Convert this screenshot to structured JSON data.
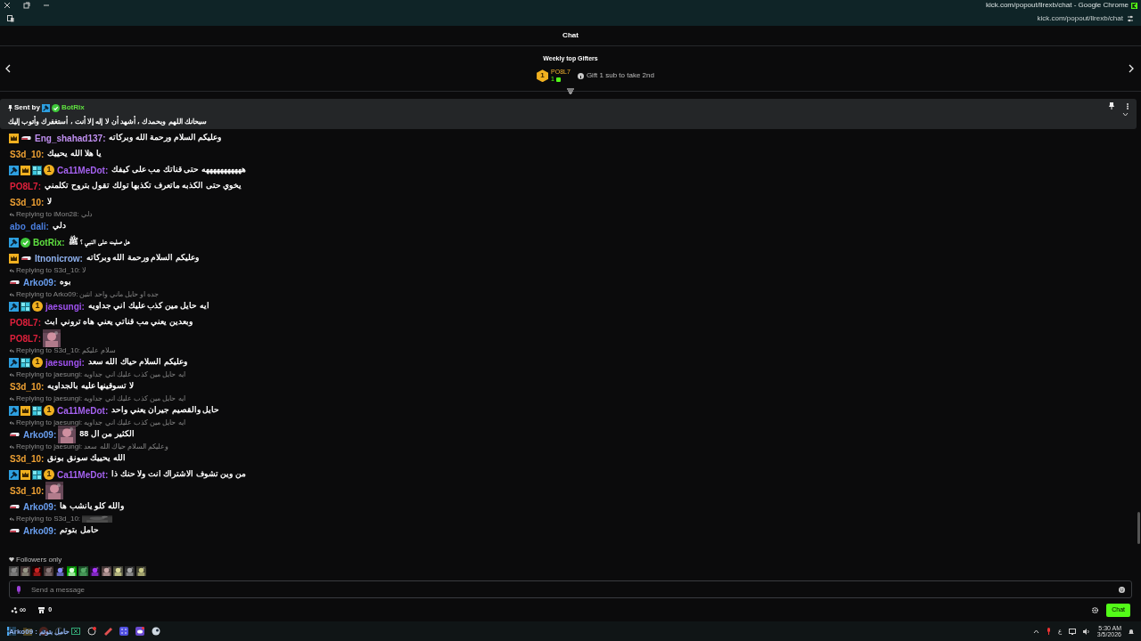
{
  "browser": {
    "title": "kick.com/popout/llrexb/chat - Google Chrome",
    "address": "kick.com/popout/llrexb/chat"
  },
  "header": {
    "title": "Chat"
  },
  "gifters": {
    "title": "Weekly top Gifters",
    "rank": "1",
    "name": "PO8L7",
    "count": "1",
    "hint": "Gift 1 sub to take 2nd"
  },
  "pinned": {
    "label": "Sent by",
    "badges": [
      {
        "kind": "moderator"
      },
      {
        "kind": "verified"
      }
    ],
    "author": "BotRix",
    "text": "سبحانك اللهم وبحمدك ، أشهد أن لا إله إلا أنت ، أستغفرك وأتوب إليك"
  },
  "messages": [
    {
      "kind": "message",
      "badges": [
        {
          "kind": "vip"
        },
        {
          "kind": "subscriber"
        }
      ],
      "author": "Eng_shahad137:",
      "color": "#c08ff0",
      "text": "وعليكم السلام ورحمة الله وبركاته"
    },
    {
      "kind": "message",
      "author": "S3d_10:",
      "color": "#f0a234",
      "text": "يا هلا الله يحييك"
    },
    {
      "kind": "message",
      "badges": [
        {
          "kind": "moderator"
        },
        {
          "kind": "vip"
        },
        {
          "kind": "og"
        },
        {
          "kind": "gifter",
          "label": "1"
        }
      ],
      "author": "Ca11MeDot:",
      "color": "#a562f0",
      "text": "هههههههههههه حتى قناتك مب على كيفك"
    },
    {
      "kind": "message",
      "author": "PO8L7:",
      "color": "#e0203c",
      "text": "يخوي حتى الكذبه ماتعرف تكذبها تولك تقول بتروح تكلمني"
    },
    {
      "kind": "message",
      "author": "S3d_10:",
      "color": "#f0a234",
      "text": "لا"
    },
    {
      "kind": "reply",
      "label": "Replying to iMon28:",
      "quote": "دلي"
    },
    {
      "kind": "message",
      "author": "abo_dali:",
      "color": "#4a7fe0",
      "text": "دلي"
    },
    {
      "kind": "message",
      "badges": [
        {
          "kind": "moderator"
        },
        {
          "kind": "verified"
        }
      ],
      "author": "BotRix:",
      "color": "#5fe040",
      "text": "هل صليت على النبي ؟ ﷺ"
    },
    {
      "kind": "message",
      "badges": [
        {
          "kind": "vip"
        },
        {
          "kind": "subscriber"
        }
      ],
      "author": "Itnonicrow:",
      "color": "#8fb2f0",
      "text": "وعليكم السلام ورحمة الله وبركاته"
    },
    {
      "kind": "reply",
      "label": "Replying to S3d_10:",
      "quote": "لا"
    },
    {
      "kind": "message",
      "badges": [
        {
          "kind": "subscriber"
        }
      ],
      "author": "Arko09:",
      "color": "#6a9ff0",
      "text": "بوه"
    },
    {
      "kind": "reply",
      "label": "Replying to Arko09:",
      "quote": "جده او حايل ماني واحد انثين"
    },
    {
      "kind": "message",
      "badges": [
        {
          "kind": "moderator"
        },
        {
          "kind": "og"
        },
        {
          "kind": "gifter",
          "label": "1"
        }
      ],
      "author": "jaesungi:",
      "color": "#a052f0",
      "text": "ايه حايل مين كذب عليك اني جداويه"
    },
    {
      "kind": "message",
      "author": "PO8L7:",
      "color": "#e0203c",
      "text": "وبعدين يعني مب قناتي يعني هاه تروني ابث"
    },
    {
      "kind": "message",
      "author": "PO8L7:",
      "color": "#e0203c",
      "emote": true
    },
    {
      "kind": "reply",
      "label": "Replying to S3d_10:",
      "quote": "سلام عليكم"
    },
    {
      "kind": "message",
      "badges": [
        {
          "kind": "moderator"
        },
        {
          "kind": "og"
        },
        {
          "kind": "gifter",
          "label": "1"
        }
      ],
      "author": "jaesungi:",
      "color": "#a052f0",
      "text": "وعليكم السلام حياك الله سعد"
    },
    {
      "kind": "reply",
      "label": "Replying to jaesungi:",
      "quote": "ايه حايل مين كذب عليك اني جداويه"
    },
    {
      "kind": "message",
      "author": "S3d_10:",
      "color": "#f0a234",
      "text": "لا تسوقينها عليه بالجداويه"
    },
    {
      "kind": "reply",
      "label": "Replying to jaesungi:",
      "quote": "ايه حايل مين كذب عليك اني جداويه"
    },
    {
      "kind": "message",
      "badges": [
        {
          "kind": "moderator"
        },
        {
          "kind": "vip"
        },
        {
          "kind": "og"
        },
        {
          "kind": "gifter",
          "label": "1"
        }
      ],
      "author": "Ca11MeDot:",
      "color": "#a562f0",
      "text": "حايل والقصيم جيران يعني واحد"
    },
    {
      "kind": "reply",
      "label": "Replying to jaesungi:",
      "quote": "ايه حايل مين كذب عليك اني جداويه"
    },
    {
      "kind": "message",
      "badges": [
        {
          "kind": "subscriber"
        }
      ],
      "author": "Arko09:",
      "color": "#6a9ff0",
      "emote": true,
      "text": "الكثير من ال 88"
    },
    {
      "kind": "reply",
      "label": "Replying to jaesungi:",
      "quote": "وعليكم السلام حياك الله سعد"
    },
    {
      "kind": "message",
      "author": "S3d_10:",
      "color": "#f0a234",
      "text": "الله يحييك سونق بونق"
    },
    {
      "kind": "message",
      "badges": [
        {
          "kind": "moderator"
        },
        {
          "kind": "vip"
        },
        {
          "kind": "og"
        },
        {
          "kind": "gifter",
          "label": "1"
        }
      ],
      "author": "Ca11MeDot:",
      "color": "#a562f0",
      "text": "من وين تشوف الاشتراك انت ولا حنك ذا"
    },
    {
      "kind": "message",
      "author": "S3d_10:",
      "color": "#f0a234",
      "emote": true
    },
    {
      "kind": "message",
      "badges": [
        {
          "kind": "subscriber"
        }
      ],
      "author": "Arko09:",
      "color": "#6a9ff0",
      "text": "والله كلو يانشب ها"
    },
    {
      "kind": "reply",
      "label": "Replying to S3d_10:",
      "quote_image": true
    },
    {
      "kind": "message",
      "badges": [
        {
          "kind": "subscriber"
        }
      ],
      "author": "Arko09:",
      "color": "#6a9ff0",
      "text": "حامل بتوتم"
    }
  ],
  "mode": "Followers only",
  "input": {
    "placeholder": "Send a message"
  },
  "footer": {
    "points": "∞",
    "store": "0",
    "send": "Chat"
  },
  "taskbar": {
    "preview": "Arko09 : حامل بتوتم",
    "time": "5:30 AM",
    "date": "3/5/2026",
    "language": "ع"
  }
}
